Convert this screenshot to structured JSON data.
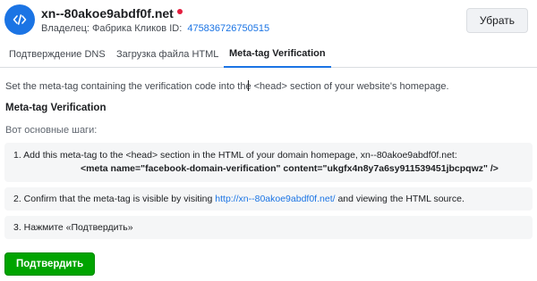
{
  "header": {
    "icon": "code-icon",
    "domain": "xn--80akoe9abdf0f.net",
    "owner_label": "Владелец: Фабрика Кликов",
    "id_label": "ID:",
    "id_value": "475836726750515",
    "remove_label": "Убрать",
    "status_color": "#e41e3f"
  },
  "tabs": [
    {
      "label": "Подтверждение DNS",
      "active": false
    },
    {
      "label": "Загрузка файла HTML",
      "active": false
    },
    {
      "label": "Meta-tag Verification",
      "active": true
    }
  ],
  "main": {
    "instruction": "Set the meta-tag containing the verification code into the <head> section of your website's homepage.",
    "section_title": "Meta-tag Verification",
    "steps_label": "Вот основные шаги:",
    "step1_text": "1. Add this meta-tag to the <head> section in the HTML of your domain homepage, xn--80akoe9abdf0f.net:",
    "step1_code": "<meta name=\"facebook-domain-verification\" content=\"ukgfx4n8y7a6sy911539451jbcpqwz\" />",
    "step2_prefix": "2. Confirm that the meta-tag is visible by visiting ",
    "step2_link": "http://xn--80akoe9abdf0f.net/",
    "step2_suffix": " and viewing the HTML source.",
    "step3_text": "3. Нажмите «Подтвердить»",
    "confirm_label": "Подтвердить"
  },
  "colors": {
    "accent": "#1b74e4",
    "confirm": "#00a400"
  }
}
